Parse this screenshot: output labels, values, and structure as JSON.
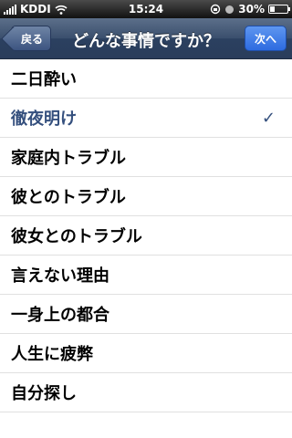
{
  "status_bar": {
    "carrier": "KDDI",
    "time": "15:24",
    "battery_percent": "30%",
    "battery_level": 0.3
  },
  "nav": {
    "back_label": "戻る",
    "title": "どんな事情ですか？",
    "next_label": "次へ"
  },
  "list": {
    "items": [
      {
        "label": "二日酔い",
        "selected": false
      },
      {
        "label": "徹夜明け",
        "selected": true
      },
      {
        "label": "家庭内トラブル",
        "selected": false
      },
      {
        "label": "彼とのトラブル",
        "selected": false
      },
      {
        "label": "彼女とのトラブル",
        "selected": false
      },
      {
        "label": "言えない理由",
        "selected": false
      },
      {
        "label": "一身上の都合",
        "selected": false
      },
      {
        "label": "人生に疲弊",
        "selected": false
      },
      {
        "label": "自分探し",
        "selected": false
      }
    ],
    "check_glyph": "✓"
  },
  "colors": {
    "selected_text": "#35507e",
    "nav_bar": "#3a4f6d",
    "next_button": "#2d6be0"
  }
}
